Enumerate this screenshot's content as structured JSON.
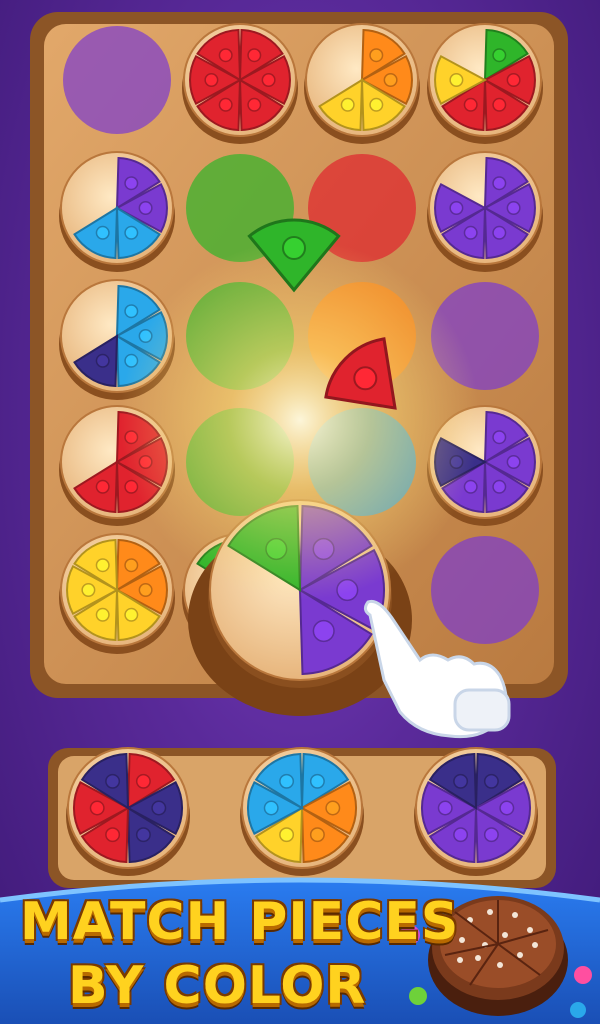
{
  "banner": {
    "line1": "MATCH PIECES",
    "line2": "BY COLOR"
  },
  "colors": {
    "red": "#e0232e",
    "orange": "#ff8a1a",
    "yellow": "#ffd22a",
    "green": "#2fb52a",
    "blue": "#2aa8ea",
    "purple": "#7a3ad0",
    "navy": "#3a2f8a",
    "board": "#c8894f",
    "tray": "#d49a5c"
  },
  "board": {
    "rows": 5,
    "cols": 4,
    "cells": [
      {
        "row": 0,
        "col": 0,
        "type": "slot",
        "color": "purple"
      },
      {
        "row": 0,
        "col": 1,
        "type": "plate",
        "slices": [
          "red",
          "red",
          "red",
          "red",
          "red",
          "red"
        ]
      },
      {
        "row": 0,
        "col": 2,
        "type": "plate",
        "slices": [
          "orange",
          "orange",
          "yellow",
          "yellow",
          "empty",
          "empty"
        ]
      },
      {
        "row": 0,
        "col": 3,
        "type": "plate",
        "slices": [
          "green",
          "red",
          "red",
          "red",
          "yellow",
          "empty"
        ]
      },
      {
        "row": 1,
        "col": 0,
        "type": "plate",
        "slices": [
          "purple",
          "purple",
          "blue",
          "blue",
          "empty",
          "empty"
        ]
      },
      {
        "row": 1,
        "col": 1,
        "type": "slot",
        "color": "green"
      },
      {
        "row": 1,
        "col": 2,
        "type": "slot",
        "color": "red"
      },
      {
        "row": 1,
        "col": 3,
        "type": "plate",
        "slices": [
          "purple",
          "purple",
          "purple",
          "purple",
          "purple",
          "empty"
        ]
      },
      {
        "row": 2,
        "col": 0,
        "type": "plate",
        "slices": [
          "blue",
          "blue",
          "blue",
          "navy",
          "empty",
          "empty"
        ]
      },
      {
        "row": 2,
        "col": 1,
        "type": "slot",
        "color": "green"
      },
      {
        "row": 2,
        "col": 2,
        "type": "slot",
        "color": "orange"
      },
      {
        "row": 2,
        "col": 3,
        "type": "slot",
        "color": "purple"
      },
      {
        "row": 3,
        "col": 0,
        "type": "plate",
        "slices": [
          "red",
          "red",
          "red",
          "red",
          "empty",
          "empty"
        ]
      },
      {
        "row": 3,
        "col": 1,
        "type": "slot",
        "color": "green"
      },
      {
        "row": 3,
        "col": 2,
        "type": "slot",
        "color": "blue"
      },
      {
        "row": 3,
        "col": 3,
        "type": "plate",
        "slices": [
          "purple",
          "purple",
          "purple",
          "purple",
          "navy",
          "empty"
        ]
      },
      {
        "row": 4,
        "col": 0,
        "type": "plate",
        "slices": [
          "orange",
          "orange",
          "yellow",
          "yellow",
          "yellow",
          "yellow"
        ]
      },
      {
        "row": 4,
        "col": 1,
        "type": "plate",
        "slices": [
          "purple",
          "purple",
          "purple",
          "empty",
          "empty",
          "green"
        ]
      },
      {
        "row": 4,
        "col": 2,
        "type": "empty"
      },
      {
        "row": 4,
        "col": 3,
        "type": "slot",
        "color": "purple"
      }
    ]
  },
  "floating_pieces": [
    {
      "color": "green",
      "label": "flying-green-piece"
    },
    {
      "color": "red",
      "label": "flying-red-piece"
    }
  ],
  "tray": {
    "plates": [
      {
        "slices": [
          "red",
          "navy",
          "navy",
          "red",
          "red",
          "navy"
        ]
      },
      {
        "slices": [
          "blue",
          "orange",
          "orange",
          "yellow",
          "blue",
          "blue"
        ]
      },
      {
        "slices": [
          "navy",
          "purple",
          "purple",
          "purple",
          "purple",
          "navy"
        ]
      }
    ]
  },
  "icons": [
    "pointing-hand-icon",
    "chocolate-cake-icon",
    "candy-icon"
  ]
}
